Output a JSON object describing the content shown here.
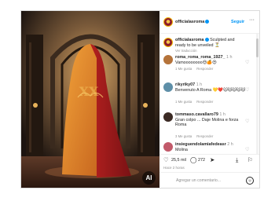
{
  "post": {
    "author": "officialasroma",
    "follow_label": "Seguir",
    "more_label": "···",
    "ai_badge": "AI"
  },
  "caption": {
    "username": "officialasroma",
    "text": "Sculpted and ready to be unveiled ⏳",
    "meta": "Ver traducción"
  },
  "comments": [
    {
      "username": "roma_roma_roma_1927_",
      "time": "1 h",
      "text": "Vamoooooooo😍🍊😍",
      "likes": "1 Me gusta",
      "reply": "Responder"
    },
    {
      "username": "rikyriky07",
      "time": "1 h",
      "text": "Benvenuto A Roma 💛❤️🐱🐱🐱🐱🐱",
      "likes": "1 Me gusta",
      "reply": "Responder"
    },
    {
      "username": "tommaso.cavallaro79",
      "time": "1 h",
      "text": "Gran colpo ... Daje Molina e forza Roma",
      "likes": "3 Me gusta",
      "reply": "Responder"
    },
    {
      "username": "insieguendolamiafedeasr",
      "time": "2 h",
      "text": "Molina",
      "likes": "",
      "reply": ""
    }
  ],
  "actions": {
    "likes_count": "25,5 mil",
    "comments_count": "272"
  },
  "date": "Hace 2 horas",
  "add_comment_placeholder": "Agregar un comentario...",
  "colors": {
    "accent": "#0095f6",
    "roma_red": "#8e1b2b",
    "roma_gold": "#f2c24a"
  }
}
